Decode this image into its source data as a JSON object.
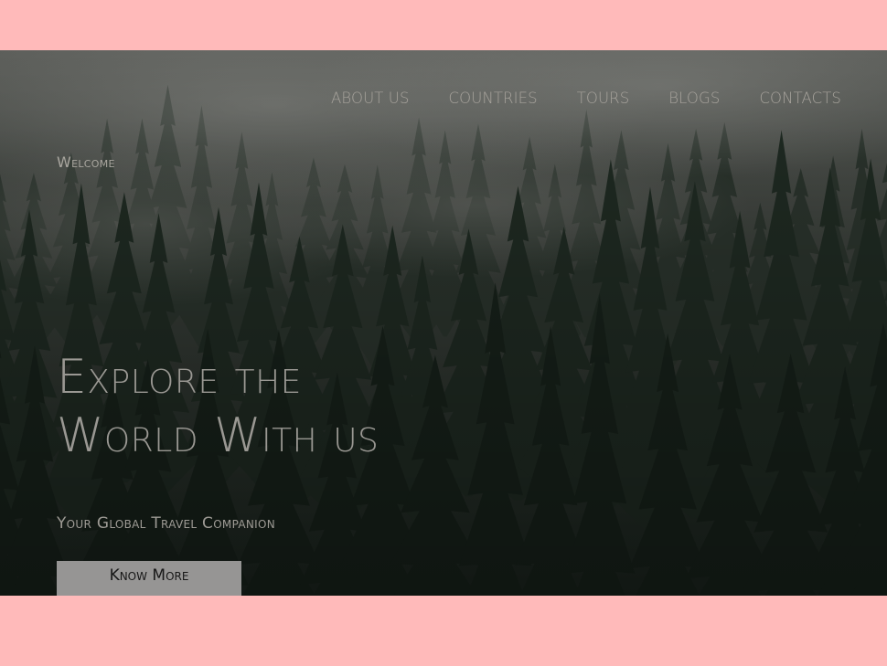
{
  "nav": {
    "items": [
      {
        "label": "ABOUT US"
      },
      {
        "label": "COUNTRIES"
      },
      {
        "label": "TOURS"
      },
      {
        "label": "BLOGS"
      },
      {
        "label": "CONTACTS"
      }
    ]
  },
  "hero": {
    "welcome": "Welcome",
    "headline_line1": "Explore the",
    "headline_line2": "World With us",
    "tagline": "Your Global Travel Companion",
    "cta_label": "Know More"
  },
  "colors": {
    "page_background": "#ffbaba",
    "hero_background": "#1d2620",
    "button_background": "#969594"
  },
  "background_image": "misty-pine-forest"
}
